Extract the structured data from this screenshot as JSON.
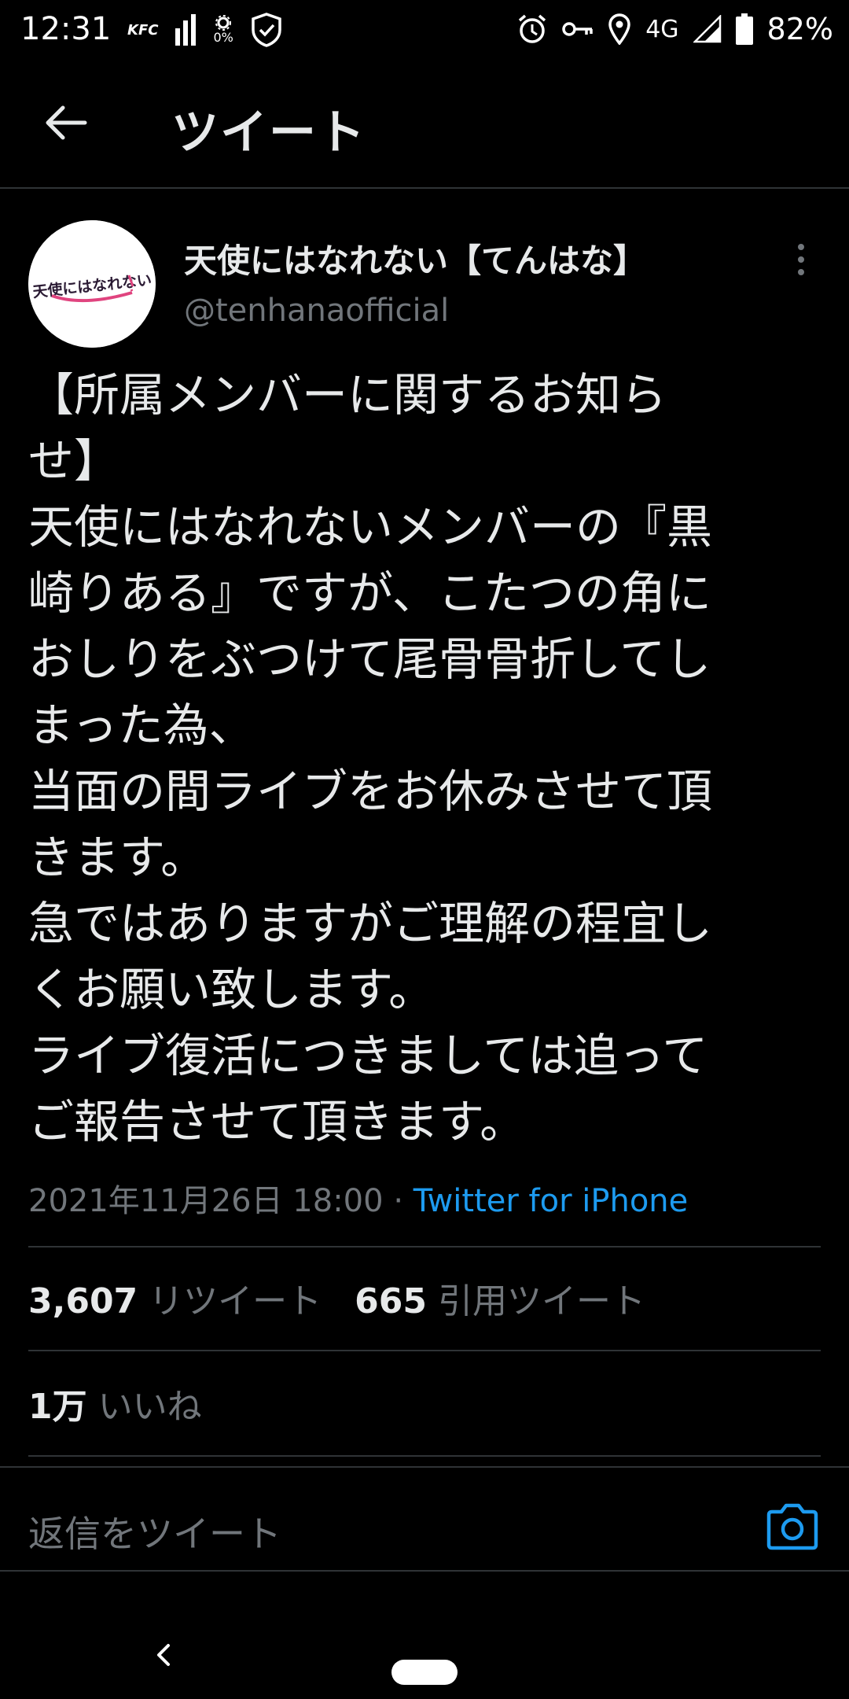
{
  "status_bar": {
    "time": "12:31",
    "left_icons": [
      "kfc-icon",
      "signal-bars-icon",
      "gear-icon",
      "shield-check-icon"
    ],
    "kfc_label": "KFC",
    "usage_label": "0%",
    "right_icons": [
      "alarm-icon",
      "key-icon",
      "location-icon",
      "cell-signal-icon",
      "battery-icon"
    ],
    "network": "4G",
    "battery": "82%"
  },
  "header": {
    "title": "ツイート"
  },
  "tweet": {
    "author": {
      "display_name": "天使にはなれない【てんはな】",
      "handle": "@tenhanaofficial",
      "avatar_text": "天使にはなれない"
    },
    "text_lines": [
      "【所属メンバーに関するお知ら",
      "せ】",
      "天使にはなれないメンバーの『黒",
      "崎りある』ですが、こたつの角に",
      "おしりをぶつけて尾骨骨折してし",
      "まった為、",
      "当面の間ライブをお休みさせて頂",
      "きます。",
      "急ではありますがご理解の程宜し",
      "くお願い致します。",
      "ライブ復活につきましては追って",
      "ご報告させて頂きます。"
    ],
    "timestamp": "2021年11月26日 18:00",
    "separator": "·",
    "source": "Twitter for iPhone"
  },
  "stats": {
    "retweets_count": "3,607",
    "retweets_label": "リツイート",
    "quotes_count": "665",
    "quotes_label": "引用ツイート",
    "likes_count": "1万",
    "likes_label": "いいね"
  },
  "reply": {
    "placeholder": "返信をツイート"
  },
  "colors": {
    "background": "#000000",
    "accent": "#1d9bf0",
    "text": "#e7e9ea",
    "secondary": "#71767b",
    "divider": "#2f3336"
  }
}
